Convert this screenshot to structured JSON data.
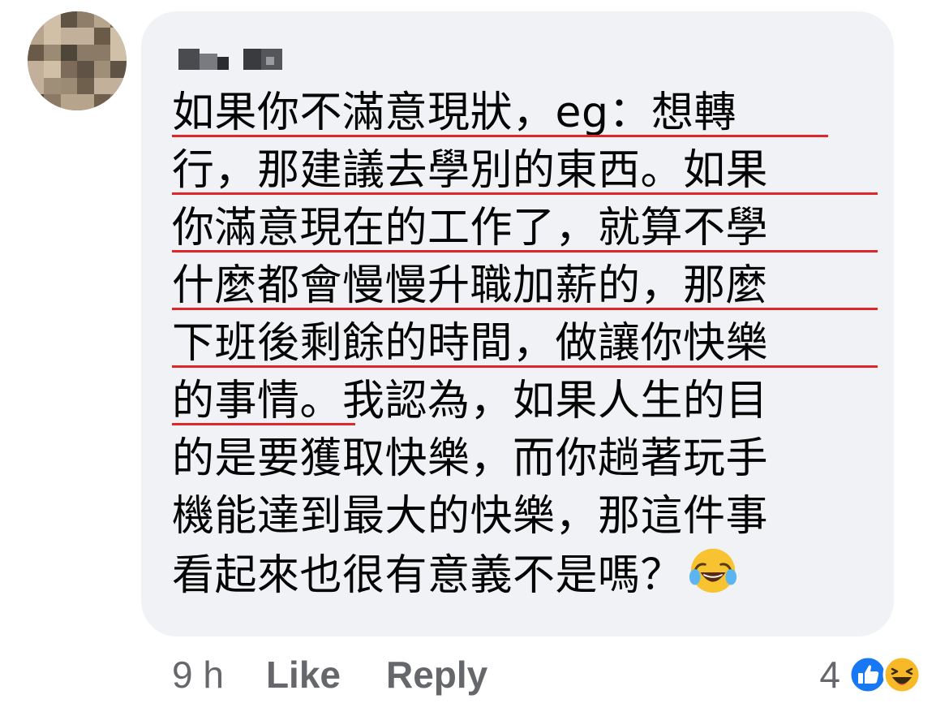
{
  "comment": {
    "author_name": "",
    "body_lines": [
      "如果你不滿意現狀，eg：想轉",
      "行，那建議去學別的東西。如果",
      "你滿意現在的工作了，就算不學",
      "什麼都會慢慢升職加薪的，那麼",
      "下班後剩餘的時間，做讓你快樂",
      "的事情。我認為，如果人生的目",
      "的是要獲取快樂，而你趟著玩手",
      "機能達到最大的快樂，那這件事",
      "看起來也很有意義不是嗎？"
    ],
    "underlined_fraction": [
      0.93,
      1.0,
      1.0,
      1.0,
      1.0,
      0.26,
      0,
      0,
      0
    ],
    "underline_color": "#e0262b",
    "trailing_emoji": "laughing-with-tears-emoji"
  },
  "meta": {
    "time": "9 h",
    "like_label": "Like",
    "reply_label": "Reply"
  },
  "reactions": {
    "count": "4",
    "icons": [
      "like-reaction-icon",
      "haha-reaction-icon"
    ]
  },
  "colors": {
    "bubble_bg": "#f0f2f5",
    "text": "#050505",
    "meta_text": "#65676b",
    "like_blue": "#1877f2",
    "haha_yellow": "#f7b928"
  }
}
